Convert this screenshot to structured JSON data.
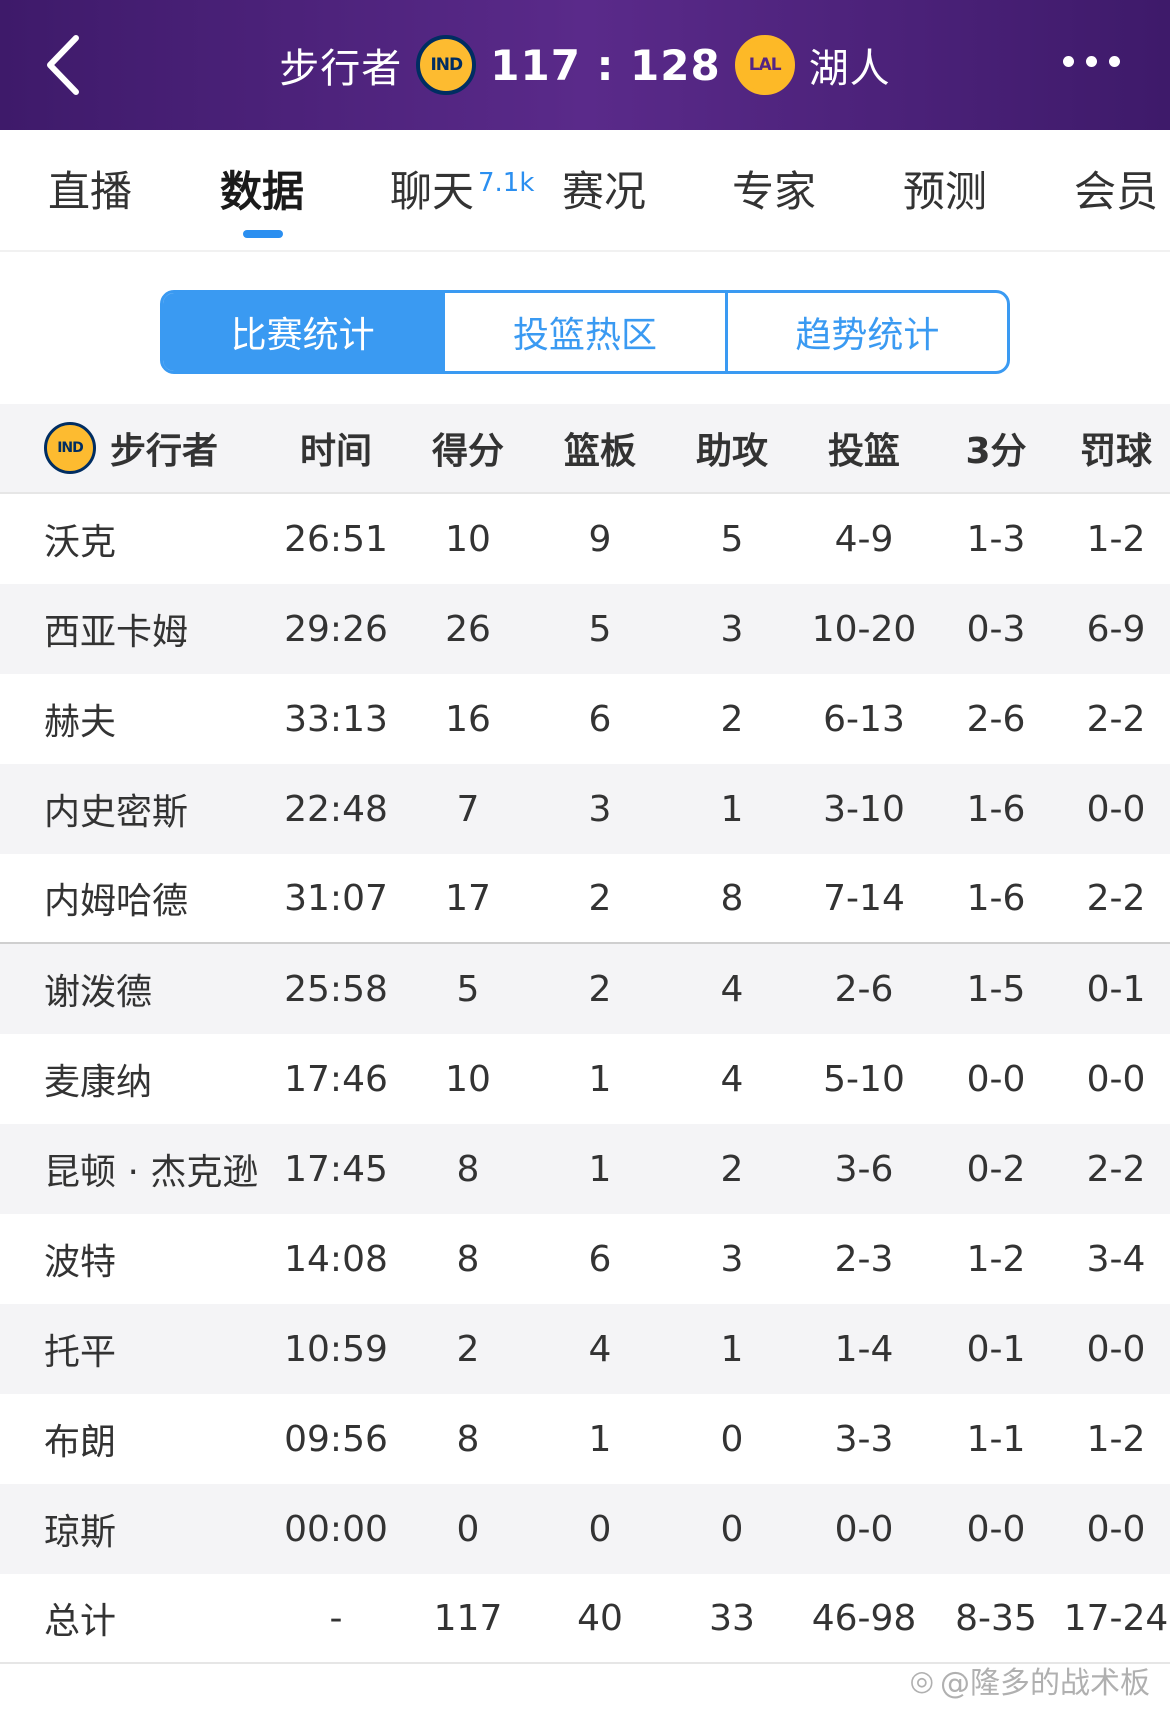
{
  "header": {
    "home_team": "步行者",
    "home_logo": "IND",
    "score": "117 : 128",
    "away_logo": "LAL",
    "away_team": "湖人",
    "back_icon": "chevron-left-icon",
    "more_icon": "more-dots-icon",
    "bg_color": "#4a1f7a"
  },
  "tabs": [
    {
      "label": "直播"
    },
    {
      "label": "数据",
      "active": true
    },
    {
      "label": "聊天",
      "badge": "7.1k"
    },
    {
      "label": "赛况"
    },
    {
      "label": "专家"
    },
    {
      "label": "预测"
    },
    {
      "label": "会员"
    }
  ],
  "segments": [
    {
      "label": "比赛统计",
      "active": true
    },
    {
      "label": "投篮热区"
    },
    {
      "label": "趋势统计"
    }
  ],
  "table": {
    "team_logo": "IND",
    "team_name": "步行者",
    "headers": [
      "时间",
      "得分",
      "篮板",
      "助攻",
      "投篮",
      "3分",
      "罚球"
    ],
    "rows": [
      [
        "沃克",
        "26:51",
        "10",
        "9",
        "5",
        "4-9",
        "1-3",
        "1-2"
      ],
      [
        "西亚卡姆",
        "29:26",
        "26",
        "5",
        "3",
        "10-20",
        "0-3",
        "6-9"
      ],
      [
        "赫夫",
        "33:13",
        "16",
        "6",
        "2",
        "6-13",
        "2-6",
        "2-2"
      ],
      [
        "内史密斯",
        "22:48",
        "7",
        "3",
        "1",
        "3-10",
        "1-6",
        "0-0"
      ],
      [
        "内姆哈德",
        "31:07",
        "17",
        "2",
        "8",
        "7-14",
        "1-6",
        "2-2"
      ],
      [
        "谢泼德",
        "25:58",
        "5",
        "2",
        "4",
        "2-6",
        "1-5",
        "0-1"
      ],
      [
        "麦康纳",
        "17:46",
        "10",
        "1",
        "4",
        "5-10",
        "0-0",
        "0-0"
      ],
      [
        "昆顿 · 杰克逊",
        "17:45",
        "8",
        "1",
        "2",
        "3-6",
        "0-2",
        "2-2"
      ],
      [
        "波特",
        "14:08",
        "8",
        "6",
        "3",
        "2-3",
        "1-2",
        "3-4"
      ],
      [
        "托平",
        "10:59",
        "2",
        "4",
        "1",
        "1-4",
        "0-1",
        "0-0"
      ],
      [
        "布朗",
        "09:56",
        "8",
        "1",
        "0",
        "3-3",
        "1-1",
        "1-2"
      ],
      [
        "琼斯",
        "00:00",
        "0",
        "0",
        "0",
        "0-0",
        "0-0",
        "0-0"
      ]
    ],
    "total": [
      "总计",
      "-",
      "117",
      "40",
      "33",
      "46-98",
      "8-35",
      "17-24"
    ]
  },
  "watermark": "@隆多的战术板"
}
